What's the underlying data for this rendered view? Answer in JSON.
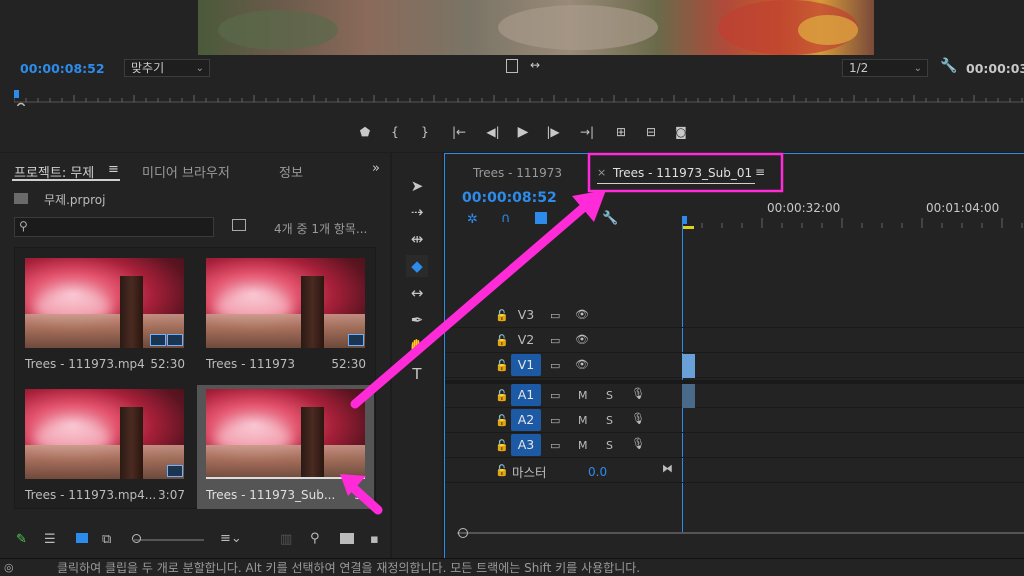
{
  "monitor": {
    "timecode_left": "00:00:08:52",
    "fit_label": "맞추기",
    "resolution": "1/2",
    "timecode_right": "00:00:03"
  },
  "project": {
    "tabs": [
      {
        "label": "프로젝트: 무제",
        "active": true
      },
      {
        "label": "미디어 브라우저",
        "active": false
      },
      {
        "label": "정보",
        "active": false
      }
    ],
    "file_name": "무제.prproj",
    "search_placeholder": "",
    "item_count": "4개 중 1개 항목...",
    "items": [
      {
        "name": "Trees - 111973.mp4",
        "duration": "52:30"
      },
      {
        "name": "Trees - 111973",
        "duration": "52:30"
      },
      {
        "name": "Trees - 111973.mp4...",
        "duration": "3:07"
      },
      {
        "name": "Trees - 111973_Sub...",
        "duration": "3:"
      }
    ]
  },
  "timeline": {
    "tabs": [
      {
        "label": "Trees - 111973",
        "active": false
      },
      {
        "label": "Trees - 111973_Sub_01",
        "active": true
      }
    ],
    "timecode": "00:00:08:52",
    "ruler_labels": [
      "00:00:32:00",
      "00:01:04:00"
    ],
    "video_tracks": [
      "V3",
      "V2",
      "V1"
    ],
    "audio_tracks": [
      "A1",
      "A2",
      "A3"
    ],
    "master_label": "마스터",
    "master_value": "0.0",
    "mute_label": "M",
    "solo_label": "S"
  },
  "status_bar": {
    "text": "클릭하여 클립을 두 개로 분할합니다. Alt 키를 선택하여 연결을 재정의합니다. 모든 트랙에는 Shift 키를 사용합니다."
  },
  "colors": {
    "accent": "#2d8ceb",
    "annotation": "#ff2bd8"
  }
}
